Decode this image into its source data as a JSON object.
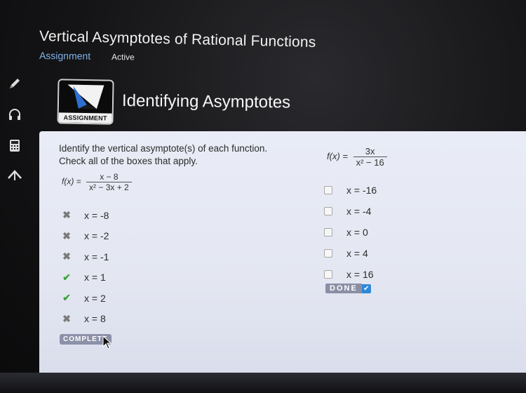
{
  "header": {
    "title": "Vertical Asymptotes of Rational Functions",
    "assignment_label": "Assignment",
    "status": "Active"
  },
  "section": {
    "badge_text": "ASSIGNMENT",
    "heading": "Identifying Asymptotes"
  },
  "question": {
    "line1": "Identify the vertical asymptote(s) of each function.",
    "line2": "Check all of the boxes that apply."
  },
  "function_left": {
    "name": "f(x) =",
    "numerator": "x − 8",
    "denominator": "x² − 3x + 2"
  },
  "function_right": {
    "name": "f(x) =",
    "numerator": "3x",
    "denominator": "x² − 16"
  },
  "left_options": [
    {
      "label": "x = -8",
      "result": "incorrect"
    },
    {
      "label": "x = -2",
      "result": "incorrect"
    },
    {
      "label": "x = -1",
      "result": "incorrect"
    },
    {
      "label": "x = 1",
      "result": "correct"
    },
    {
      "label": "x = 2",
      "result": "correct"
    },
    {
      "label": "x = 8",
      "result": "incorrect"
    }
  ],
  "right_options": [
    {
      "label": "x = -16",
      "checked": false
    },
    {
      "label": "x = -4",
      "checked": false
    },
    {
      "label": "x = 0",
      "checked": false
    },
    {
      "label": "x = 4",
      "checked": false
    },
    {
      "label": "x = 16",
      "checked": false
    }
  ],
  "buttons": {
    "done": "DONE",
    "complete": "COMPLETE"
  },
  "icons": {
    "sidebar": [
      "pencil-icon",
      "headphones-icon",
      "calculator-icon",
      "arrow-up-icon"
    ],
    "badge": "pen-nib-icon",
    "correct": "checkmark-icon",
    "incorrect": "x-mark-icon",
    "cursor": "mouse-pointer-icon"
  },
  "colors": {
    "panel_bg": "#e9ecf6",
    "accent_blue": "#2f88d8",
    "correct_green": "#3fa33f",
    "incorrect_gray": "#7a7a7a",
    "button_gray": "#8c91a8",
    "header_link": "#7fb2e6"
  }
}
